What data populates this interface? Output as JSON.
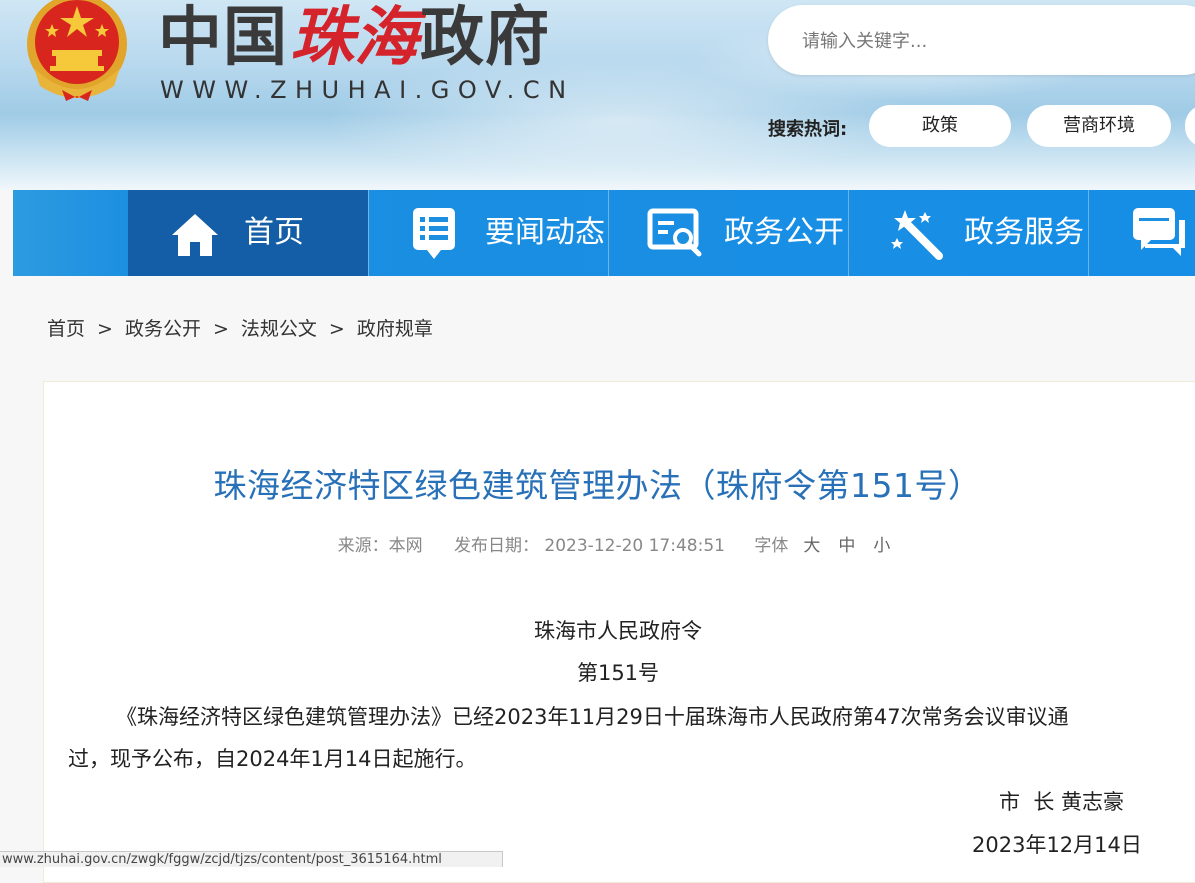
{
  "header": {
    "logo": {
      "chars_plain": "中国",
      "chars_calligraphy": "珠海",
      "chars_plain_2": "政府",
      "url": "WWW.ZHUHAI.GOV.CN"
    },
    "search": {
      "placeholder": "请输入关键字..."
    },
    "hot": {
      "label": "搜索热词:",
      "tags": [
        "政策",
        "营商环境"
      ]
    }
  },
  "nav": {
    "items": [
      {
        "label": "首页",
        "icon": "home-icon",
        "active": true
      },
      {
        "label": "要闻动态",
        "icon": "news-icon"
      },
      {
        "label": "政务公开",
        "icon": "open-affairs-icon"
      },
      {
        "label": "政务服务",
        "icon": "service-wand-icon"
      },
      {
        "label": "",
        "icon": "chat-icon"
      }
    ]
  },
  "breadcrumb": [
    "首页",
    "政务公开",
    "法规公文",
    "政府规章"
  ],
  "article": {
    "title": "珠海经济特区绿色建筑管理办法（珠府令第151号）",
    "meta": {
      "source": "来源：本网",
      "date": "发布日期：  2023-12-20 17:48:51",
      "font_label": "字体",
      "sizes": [
        "大",
        "中",
        "小"
      ]
    },
    "order_title": "珠海市人民政府令",
    "order_number": "第151号",
    "para_line1": "《珠海经济特区绿色建筑管理办法》已经2023年11月29日十届珠海市人民政府第47次常务会议审议通",
    "para_line2": "过，现予公布，自2024年1月14日起施行。",
    "signature": "市  长 黄志豪",
    "sign_date": "2023年12月14日"
  },
  "status_bar": {
    "url": "www.zhuhai.gov.cn/zwgk/fggw/zcjd/tjzs/content/post_3615164.html"
  },
  "colors": {
    "nav_blue": "#168ee6",
    "nav_active": "#135ea6",
    "title_blue": "#2871b8",
    "emblem_red": "#d8261f",
    "calligraphy_red": "#d4232a"
  }
}
